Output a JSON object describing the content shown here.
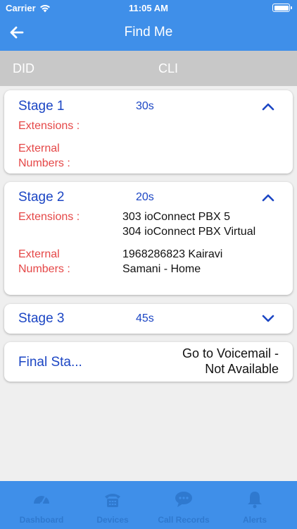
{
  "status_bar": {
    "carrier": "Carrier",
    "time": "11:05 AM"
  },
  "nav": {
    "title": "Find Me"
  },
  "columns": {
    "did": "DID",
    "cli": "CLI"
  },
  "stages": [
    {
      "name": "Stage 1",
      "time": "30s",
      "extensions_label": "Extensions :",
      "external_label_1": "External",
      "external_label_2": "Numbers :"
    },
    {
      "name": "Stage 2",
      "time": "20s",
      "extensions_label": "Extensions :",
      "extension_1": "303 ioConnect PBX 5",
      "extension_2": "304 ioConnect PBX Virtual",
      "external_label_1": "External",
      "external_label_2": "Numbers :",
      "external_number_1": "1968286823 Kairavi",
      "external_number_2": "Samani - Home"
    },
    {
      "name": "Stage 3",
      "time": "45s"
    }
  ],
  "final_stage": {
    "name": "Final Sta...",
    "value_1": "Go to Voicemail -",
    "value_2": "Not Available"
  },
  "tabbar": {
    "items": [
      {
        "label": "Dashboard"
      },
      {
        "label": "Devices"
      },
      {
        "label": "Call Records"
      },
      {
        "label": "Alerts"
      }
    ]
  },
  "colors": {
    "primary": "#3f8fe9",
    "header_gray": "#c8c8c8",
    "stage_blue": "#1c46c4",
    "label_red": "#e54747"
  }
}
